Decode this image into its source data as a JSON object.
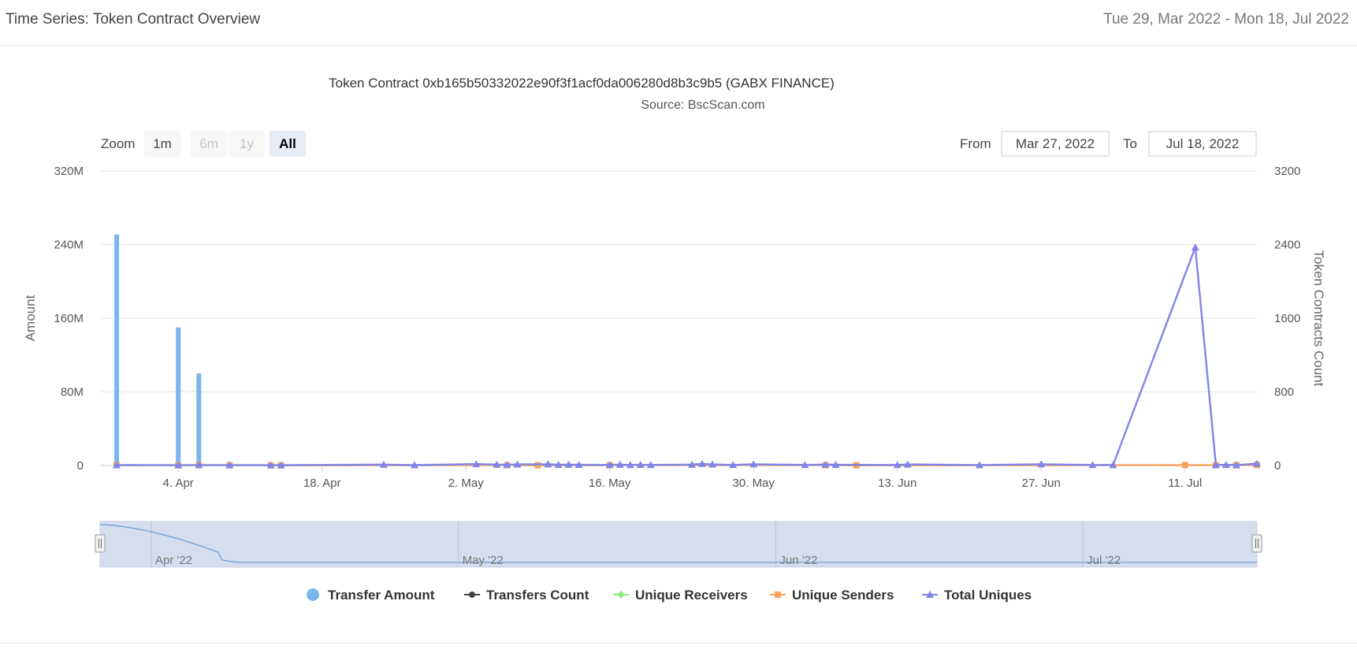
{
  "header": {
    "title": "Time Series: Token Contract Overview",
    "date_range": "Tue 29, Mar 2022 - Mon 18, Jul 2022"
  },
  "range_selector": {
    "zoom_label": "Zoom",
    "buttons": [
      "1m",
      "6m",
      "1y",
      "All"
    ],
    "selected": "All",
    "from_label": "From",
    "from_value": "Mar 27, 2022",
    "to_label": "To",
    "to_value": "Jul 18, 2022"
  },
  "navigator": {
    "labels": [
      "Apr '22",
      "May '22",
      "Jun '22",
      "Jul '22"
    ]
  },
  "colors": {
    "transfer_amount": "#7cb5ec",
    "transfers_count": "#434348",
    "unique_receivers": "#90ed7d",
    "unique_senders": "#f7a35c",
    "total_uniques": "#8085e9",
    "grid": "#e6e6e6",
    "navigator_fill": "#d5deef"
  },
  "chart_data": {
    "type": "bar",
    "title": "Token Contract 0xb165b50332022e90f3f1acf0da006280d8b3c9b5 (GABX FINANCE)",
    "subtitle": "Source: BscScan.com",
    "x_range": [
      "2022-03-29",
      "2022-07-18"
    ],
    "x_ticks": [
      "4. Apr",
      "18. Apr",
      "2. May",
      "16. May",
      "30. May",
      "13. Jun",
      "27. Jun",
      "11. Jul"
    ],
    "x_tick_dates": [
      "2022-04-04",
      "2022-04-18",
      "2022-05-02",
      "2022-05-16",
      "2022-05-30",
      "2022-06-13",
      "2022-06-27",
      "2022-07-11"
    ],
    "y_left": {
      "label": "Amount",
      "range": [
        0,
        320000000
      ],
      "ticks": [
        "0",
        "80M",
        "160M",
        "240M",
        "320M"
      ],
      "tick_values": [
        0,
        80000000,
        160000000,
        240000000,
        320000000
      ]
    },
    "y_right": {
      "label": "Token Contracts Count",
      "range": [
        0,
        3200
      ],
      "ticks": [
        "0",
        "800",
        "1600",
        "2400",
        "3200"
      ],
      "tick_values": [
        0,
        800,
        1600,
        2400,
        3200
      ]
    },
    "grid": true,
    "legend_position": "bottom-center",
    "series": [
      {
        "name": "Transfer Amount",
        "type": "column",
        "axis": "left",
        "points": [
          [
            "2022-03-29",
            251000000
          ],
          [
            "2022-04-04",
            150000000
          ],
          [
            "2022-04-06",
            100000000
          ]
        ]
      },
      {
        "name": "Transfers Count",
        "type": "line",
        "axis": "right",
        "points": []
      },
      {
        "name": "Unique Receivers",
        "type": "line",
        "axis": "right",
        "points": []
      },
      {
        "name": "Unique Senders",
        "type": "line",
        "axis": "right",
        "points": [
          [
            "2022-03-29",
            3
          ],
          [
            "2022-04-04",
            2
          ],
          [
            "2022-04-06",
            3
          ],
          [
            "2022-04-09",
            3
          ],
          [
            "2022-04-13",
            2
          ],
          [
            "2022-04-14",
            2
          ],
          [
            "2022-05-06",
            3
          ],
          [
            "2022-05-09",
            2
          ],
          [
            "2022-05-16",
            3
          ],
          [
            "2022-06-06",
            3
          ],
          [
            "2022-06-09",
            2
          ],
          [
            "2022-07-11",
            4
          ],
          [
            "2022-07-14",
            3
          ],
          [
            "2022-07-16",
            3
          ],
          [
            "2022-07-18",
            5
          ]
        ]
      },
      {
        "name": "Total Uniques",
        "type": "line",
        "axis": "right",
        "points": [
          [
            "2022-03-29",
            4
          ],
          [
            "2022-04-04",
            3
          ],
          [
            "2022-04-06",
            5
          ],
          [
            "2022-04-09",
            3
          ],
          [
            "2022-04-13",
            3
          ],
          [
            "2022-04-14",
            3
          ],
          [
            "2022-04-24",
            10
          ],
          [
            "2022-04-27",
            4
          ],
          [
            "2022-05-03",
            15
          ],
          [
            "2022-05-05",
            10
          ],
          [
            "2022-05-06",
            8
          ],
          [
            "2022-05-07",
            12
          ],
          [
            "2022-05-10",
            14
          ],
          [
            "2022-05-11",
            8
          ],
          [
            "2022-05-12",
            10
          ],
          [
            "2022-05-13",
            8
          ],
          [
            "2022-05-16",
            6
          ],
          [
            "2022-05-17",
            10
          ],
          [
            "2022-05-18",
            6
          ],
          [
            "2022-05-19",
            8
          ],
          [
            "2022-05-20",
            6
          ],
          [
            "2022-05-24",
            10
          ],
          [
            "2022-05-25",
            18
          ],
          [
            "2022-05-26",
            12
          ],
          [
            "2022-05-28",
            6
          ],
          [
            "2022-05-30",
            14
          ],
          [
            "2022-06-04",
            6
          ],
          [
            "2022-06-06",
            10
          ],
          [
            "2022-06-07",
            8
          ],
          [
            "2022-06-13",
            6
          ],
          [
            "2022-06-14",
            12
          ],
          [
            "2022-06-21",
            5
          ],
          [
            "2022-06-27",
            14
          ],
          [
            "2022-07-02",
            6
          ],
          [
            "2022-07-04",
            5
          ],
          [
            "2022-07-12",
            2370
          ],
          [
            "2022-07-14",
            6
          ],
          [
            "2022-07-15",
            8
          ],
          [
            "2022-07-16",
            5
          ],
          [
            "2022-07-18",
            20
          ]
        ]
      }
    ]
  }
}
